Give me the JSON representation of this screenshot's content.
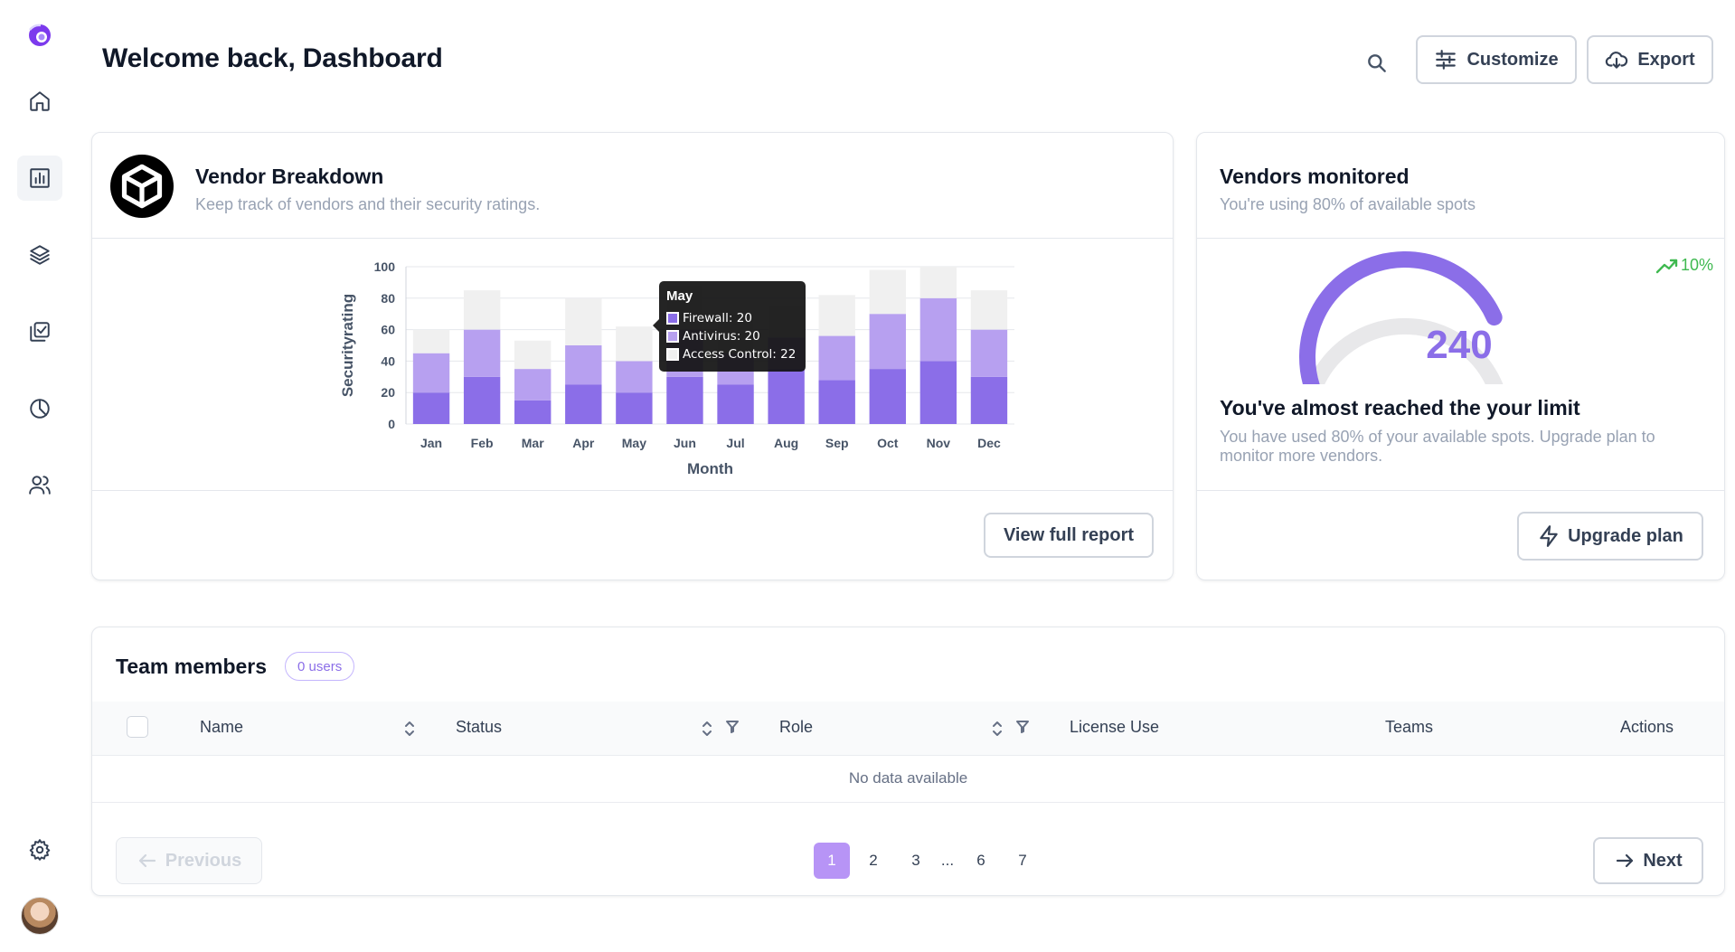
{
  "header": {
    "title": "Welcome back, Dashboard",
    "customize_label": "Customize",
    "export_label": "Export"
  },
  "sidebar": {
    "items": [
      {
        "name": "home",
        "icon": "home-icon"
      },
      {
        "name": "analytics",
        "icon": "bar-chart-icon",
        "active": true
      },
      {
        "name": "layers",
        "icon": "layers-icon"
      },
      {
        "name": "checklist",
        "icon": "check-square-icon"
      },
      {
        "name": "reports",
        "icon": "pie-chart-icon"
      },
      {
        "name": "users",
        "icon": "users-icon"
      }
    ],
    "settings_icon": "gear-icon",
    "avatar": "user-avatar"
  },
  "vendor_card": {
    "title": "Vendor Breakdown",
    "subtitle": "Keep track of vendors and their security ratings.",
    "button_label": "View full report",
    "tooltip": {
      "title": "May",
      "rows": [
        {
          "label": "Firewall: 20",
          "color": "#8b6ee8"
        },
        {
          "label": "Antivirus: 20",
          "color": "#b7a0f0"
        },
        {
          "label": "Access Control: 22",
          "color": "#f0f0f0"
        }
      ]
    }
  },
  "chart_data": {
    "type": "bar",
    "stacked": true,
    "xlabel": "Month",
    "ylabel": "Securityrating",
    "ylim": [
      0,
      100
    ],
    "yticks": [
      0,
      20,
      40,
      60,
      80,
      100
    ],
    "categories": [
      "Jan",
      "Feb",
      "Mar",
      "Apr",
      "May",
      "Jun",
      "Jul",
      "Aug",
      "Sep",
      "Oct",
      "Nov",
      "Dec"
    ],
    "series": [
      {
        "name": "Firewall",
        "color": "#8b6ee8",
        "values": [
          20,
          30,
          15,
          25,
          20,
          30,
          25,
          35,
          28,
          35,
          40,
          30
        ]
      },
      {
        "name": "Antivirus",
        "color": "#b7a0f0",
        "values": [
          25,
          30,
          20,
          25,
          20,
          30,
          20,
          20,
          28,
          35,
          40,
          30
        ]
      },
      {
        "name": "Access Control",
        "color": "#f0f0f0",
        "values": [
          15,
          25,
          18,
          30,
          22,
          28,
          25,
          20,
          26,
          28,
          20,
          25
        ]
      }
    ]
  },
  "monitor_card": {
    "title": "Vendors monitored",
    "subtitle": "You're using 80% of available spots",
    "trend": "10%",
    "gauge_value": "240",
    "gauge_fraction": 0.8,
    "limit_title": "You've almost reached the your limit",
    "limit_text": "You have used 80% of your available spots. Upgrade plan to monitor more vendors.",
    "button_label": "Upgrade plan"
  },
  "team": {
    "title": "Team members",
    "badge": "0 users",
    "columns": [
      "Name",
      "Status",
      "Role",
      "License Use",
      "Teams",
      "Actions"
    ],
    "empty_text": "No data available",
    "prev_label": "Previous",
    "next_label": "Next",
    "pages": [
      "1",
      "2",
      "3",
      "...",
      "6",
      "7"
    ],
    "current_page": "1"
  },
  "colors": {
    "accent": "#8b6ee8",
    "accent_light": "#b794f6",
    "trend_green": "#3fb950"
  }
}
